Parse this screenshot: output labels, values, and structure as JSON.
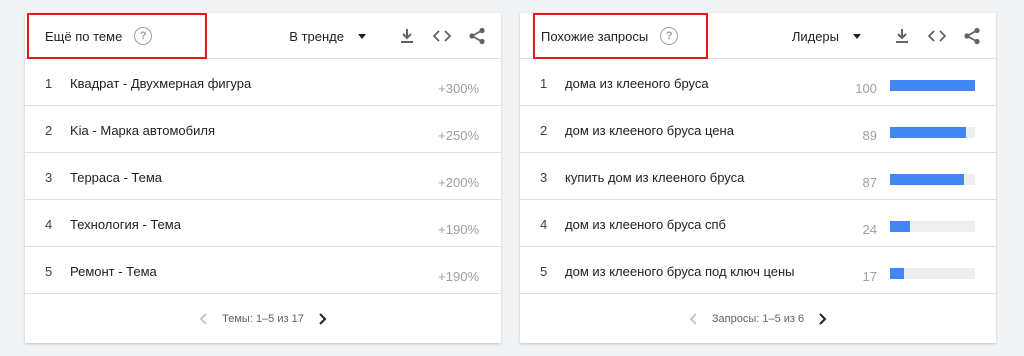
{
  "left": {
    "title": "Ещё по теме",
    "dropdown": "В тренде",
    "rows": [
      {
        "index": "1",
        "label": "Квадрат - Двухмерная фигура",
        "pct": "+300%"
      },
      {
        "index": "2",
        "label": "Kia - Марка автомобиля",
        "pct": "+250%"
      },
      {
        "index": "3",
        "label": "Терраса - Тема",
        "pct": "+200%"
      },
      {
        "index": "4",
        "label": "Технология - Тема",
        "pct": "+190%"
      },
      {
        "index": "5",
        "label": "Ремонт - Тема",
        "pct": "+190%"
      }
    ],
    "pager": "Темы: 1–5 из 17"
  },
  "right": {
    "title": "Похожие запросы",
    "dropdown": "Лидеры",
    "rows": [
      {
        "index": "1",
        "label": "дома из клееного бруса",
        "value": "100",
        "level": 100
      },
      {
        "index": "2",
        "label": "дом из клееного бруса цена",
        "value": "89",
        "level": 89
      },
      {
        "index": "3",
        "label": "купить дом из клееного бруса",
        "value": "87",
        "level": 87
      },
      {
        "index": "4",
        "label": "дом из клееного бруса спб",
        "value": "24",
        "level": 24
      },
      {
        "index": "5",
        "label": "дом из клееного бруса под ключ цены",
        "value": "17",
        "level": 17
      }
    ],
    "pager": "Запросы: 1–5 из 6"
  },
  "colors": {
    "accent": "#4285f4",
    "highlight_border": "#e8161c"
  },
  "icons": [
    "help-icon",
    "caret-down-icon",
    "download-icon",
    "embed-code-icon",
    "share-icon",
    "chevron-left-icon",
    "chevron-right-icon"
  ]
}
